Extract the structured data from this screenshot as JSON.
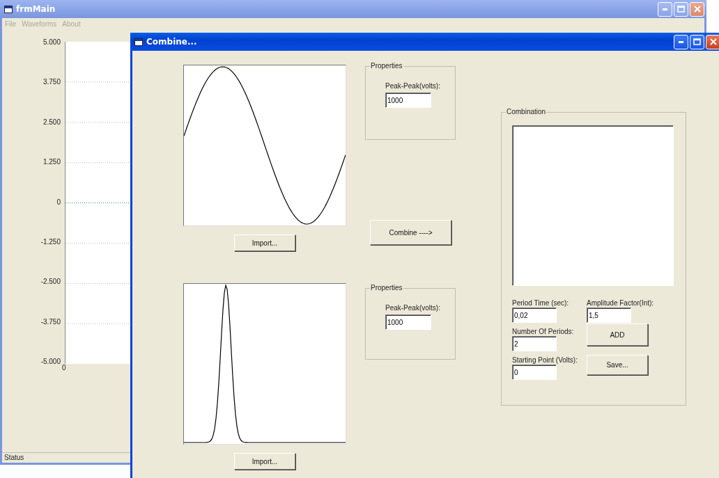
{
  "main_window": {
    "title": "frmMain",
    "menu": [
      "File",
      "Waveforms",
      "About"
    ],
    "y_ticks": [
      "5.000",
      "3.750",
      "2.500",
      "1.250",
      "0",
      "-1.250",
      "-2.500",
      "-3.750",
      "-5.000"
    ],
    "x_ticks": [
      "0"
    ],
    "status_bar": "Status"
  },
  "combine_window": {
    "title": "Combine...",
    "waveforms": [
      {
        "kind": "sine",
        "import_button": "Import...",
        "properties": {
          "title": "Properties",
          "label": "Peak-Peak(volts):",
          "value": "1000"
        }
      },
      {
        "kind": "pulse",
        "import_button": "Import...",
        "properties": {
          "title": "Properties",
          "label": "Peak-Peak(volts):",
          "value": "1000"
        }
      }
    ],
    "combine_button": "Combine  ---->",
    "combination": {
      "title": "Combination",
      "fields": [
        {
          "label": "Period Time (sec):",
          "value": "0,02"
        },
        {
          "label": "Amplitude Factor(Int):",
          "value": "1,5"
        },
        {
          "label": "Number Of Periods:",
          "value": "2"
        },
        {
          "label": "Starting Point (Volts):",
          "value": "0"
        }
      ],
      "buttons": [
        "ADD",
        "Save..."
      ]
    }
  }
}
